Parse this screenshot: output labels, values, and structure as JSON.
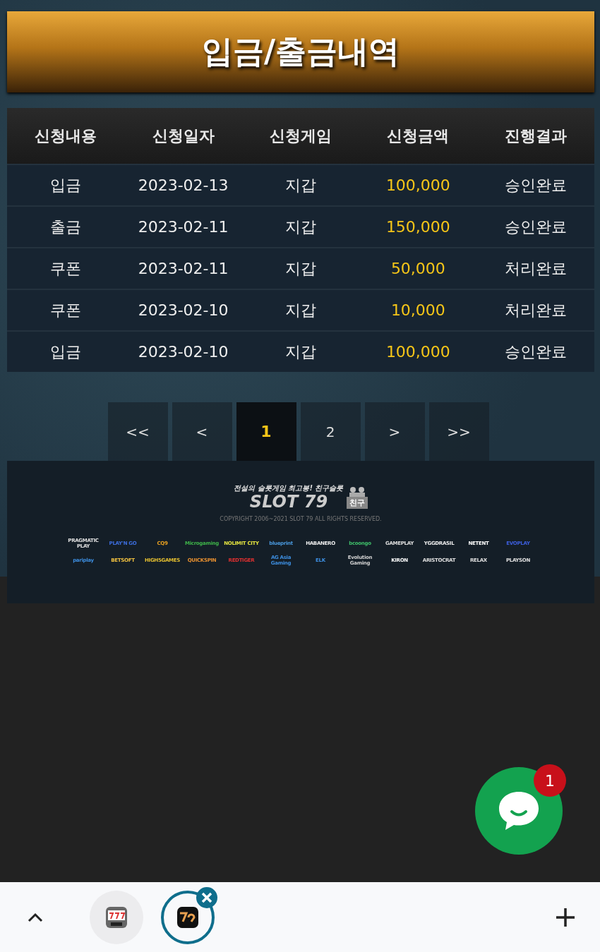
{
  "title": "입금/출금내역",
  "table": {
    "columns": [
      "신청내용",
      "신청일자",
      "신청게임",
      "신청금액",
      "진행결과"
    ],
    "rows": [
      {
        "type": "입금",
        "date": "2023-02-13",
        "game": "지갑",
        "amount": "100,000",
        "result": "승인완료"
      },
      {
        "type": "출금",
        "date": "2023-02-11",
        "game": "지갑",
        "amount": "150,000",
        "result": "승인완료"
      },
      {
        "type": "쿠폰",
        "date": "2023-02-11",
        "game": "지갑",
        "amount": "50,000",
        "result": "처리완료"
      },
      {
        "type": "쿠폰",
        "date": "2023-02-10",
        "game": "지갑",
        "amount": "10,000",
        "result": "처리완료"
      },
      {
        "type": "입금",
        "date": "2023-02-10",
        "game": "지갑",
        "amount": "100,000",
        "result": "승인완료"
      }
    ]
  },
  "pagination": [
    {
      "label": "<<",
      "selected": false
    },
    {
      "label": "<",
      "selected": false
    },
    {
      "label": "1",
      "selected": true
    },
    {
      "label": "2",
      "selected": false
    },
    {
      "label": ">",
      "selected": false
    },
    {
      "label": ">>",
      "selected": false
    }
  ],
  "footer": {
    "tagline": "전설의 슬롯게임 최고봉! 친구슬롯",
    "logo": "SLOT 79",
    "logo_badge": "친구",
    "copyright": "COPYRIGHT  2006~2021 SLOT 79 ALL RIGHTS RESERVED.",
    "providers": [
      {
        "name": "PRAGMATIC PLAY",
        "color": "#e0e0e0"
      },
      {
        "name": "PLAY'N GO",
        "color": "#3d6fe0"
      },
      {
        "name": "CQ9",
        "color": "#e8a020"
      },
      {
        "name": "Microgaming",
        "color": "#3fb54a"
      },
      {
        "name": "NOLIMIT CITY",
        "color": "#e6e640"
      },
      {
        "name": "blueprint",
        "color": "#4a9ae0"
      },
      {
        "name": "HABANERO",
        "color": "#f0f0f0"
      },
      {
        "name": "bcoongo",
        "color": "#3fc06a"
      },
      {
        "name": "GAMEPLAY",
        "color": "#e0e0e0"
      },
      {
        "name": "YGGDRASIL",
        "color": "#f0f0f0"
      },
      {
        "name": "NETENT",
        "color": "#ffffff"
      },
      {
        "name": "EVOPLAY",
        "color": "#3d5fe0"
      },
      {
        "name": "pariplay",
        "color": "#3d8ee0"
      },
      {
        "name": "BETSOFT",
        "color": "#f0c040"
      },
      {
        "name": "HIGH5GAMES",
        "color": "#e6c030"
      },
      {
        "name": "QUICKSPIN",
        "color": "#e89030"
      },
      {
        "name": "REDTIGER",
        "color": "#e03030"
      },
      {
        "name": "AG Asia Gaming",
        "color": "#3d8ee0"
      },
      {
        "name": "ELK",
        "color": "#3d8ee0"
      },
      {
        "name": "Evolution Gaming",
        "color": "#d0d0d0"
      },
      {
        "name": "KIRON",
        "color": "#ffffff"
      },
      {
        "name": "ARISTOCRAT",
        "color": "#e0e0e0"
      },
      {
        "name": "RELAX",
        "color": "#e0e0e0"
      },
      {
        "name": "PLAYSON",
        "color": "#e0e0e0"
      }
    ]
  },
  "chat": {
    "badge": "1"
  }
}
